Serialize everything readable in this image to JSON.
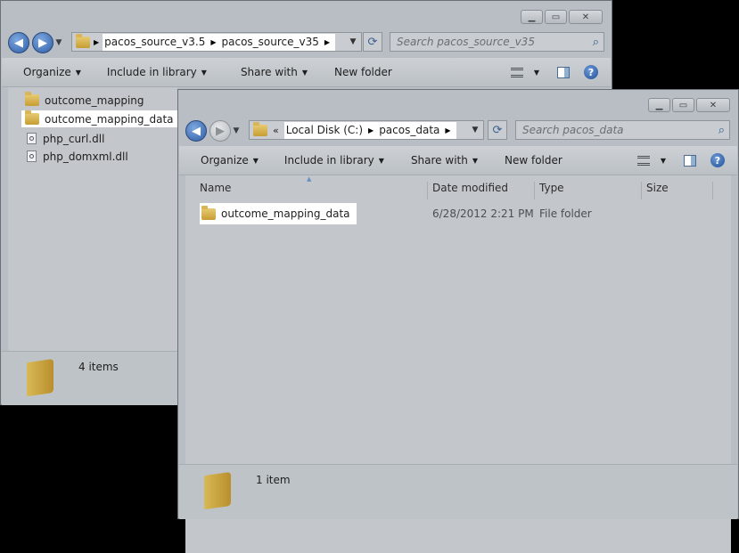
{
  "back_window": {
    "breadcrumbs": [
      "pacos_source_v3.5",
      "pacos_source_v35"
    ],
    "search_placeholder": "Search pacos_source_v35",
    "toolbar": {
      "organize": "Organize",
      "include": "Include in library",
      "share": "Share with",
      "new_folder": "New folder"
    },
    "files": [
      {
        "name": "outcome_mapping",
        "type": "folder",
        "highlighted": false
      },
      {
        "name": "outcome_mapping_data",
        "type": "folder",
        "highlighted": true
      },
      {
        "name": "php_curl.dll",
        "type": "dll",
        "highlighted": false
      },
      {
        "name": "php_domxml.dll",
        "type": "dll",
        "highlighted": false
      }
    ],
    "status": "4 items"
  },
  "front_window": {
    "breadcrumb_prefix": "«",
    "breadcrumbs": [
      "Local Disk (C:)",
      "pacos_data"
    ],
    "search_placeholder": "Search pacos_data",
    "toolbar": {
      "organize": "Organize",
      "include": "Include in library",
      "share": "Share with",
      "new_folder": "New folder"
    },
    "columns": {
      "name": "Name",
      "date": "Date modified",
      "type": "Type",
      "size": "Size"
    },
    "rows": [
      {
        "name": "outcome_mapping_data",
        "date": "6/28/2012 2:21 PM",
        "type": "File folder",
        "size": ""
      }
    ],
    "status": "1 item"
  },
  "icons": {
    "back": "back-arrow-icon",
    "forward": "forward-arrow-icon",
    "refresh": "refresh-icon",
    "search": "search-icon",
    "views": "views-icon",
    "preview_pane": "preview-pane-icon",
    "help": "help-icon"
  },
  "colors": {
    "highlight": "#ffffff",
    "chrome": "#b9bec4",
    "nav_blue": "#2e5da5"
  }
}
